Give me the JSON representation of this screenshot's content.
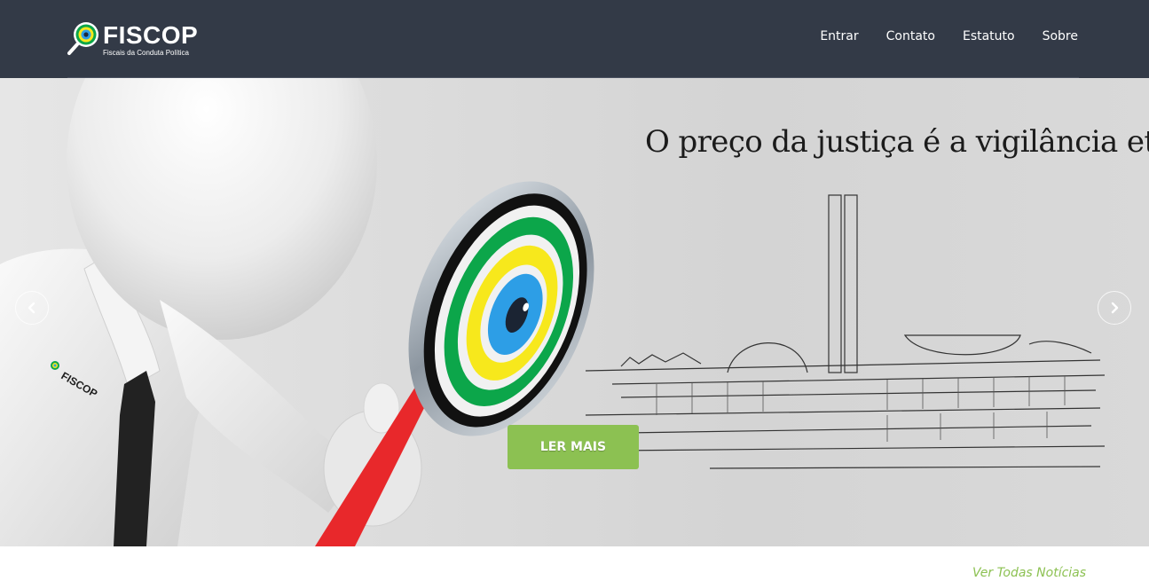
{
  "brand": {
    "name": "FISCOP",
    "tagline": "Fiscais da Conduta Política",
    "icon": "magnifier-eye-logo"
  },
  "nav": {
    "items": [
      {
        "label": "Entrar"
      },
      {
        "label": "Contato"
      },
      {
        "label": "Estatuto"
      },
      {
        "label": "Sobre"
      }
    ]
  },
  "hero": {
    "quote": "O preço da justiça é a vigilância eterna.",
    "badge_text": "FISCOP",
    "cta_label": "LER MAIS",
    "prev_icon": "chevron-left-icon",
    "next_icon": "chevron-right-icon"
  },
  "news": {
    "view_all_label": "Ver Todas Notícias"
  },
  "colors": {
    "navbar": "#333a47",
    "accent": "#8cc152",
    "lens_green": "#0ca64a",
    "lens_yellow": "#f7e81c",
    "lens_blue": "#2d9ee6",
    "handle_red": "#e8282b"
  }
}
